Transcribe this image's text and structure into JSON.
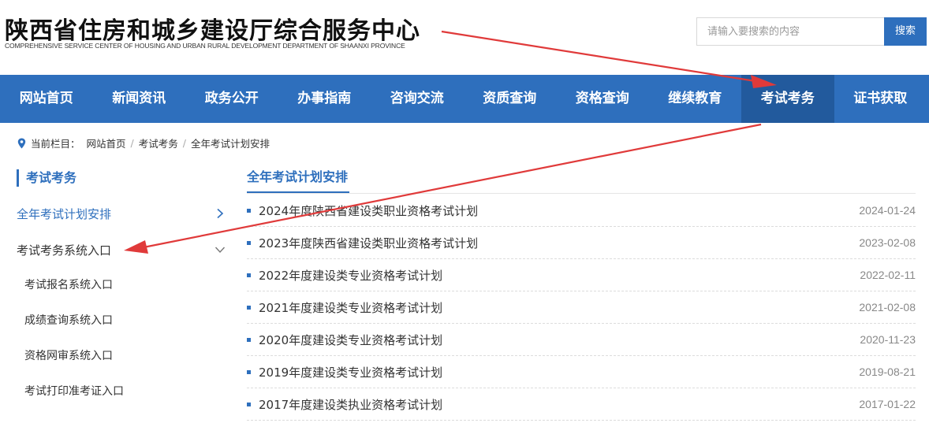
{
  "header": {
    "title": "陕西省住房和城乡建设厅综合服务中心",
    "subtitle": "COMPREHENSIVE SERVICE CENTER OF HOUSING AND URBAN RURAL DEVELOPMENT DEPARTMENT OF SHAANXI PROVINCE",
    "search_placeholder": "请输入要搜索的内容",
    "search_button": "搜索"
  },
  "nav": {
    "items": [
      {
        "label": "网站首页"
      },
      {
        "label": "新闻资讯"
      },
      {
        "label": "政务公开"
      },
      {
        "label": "办事指南"
      },
      {
        "label": "咨询交流"
      },
      {
        "label": "资质查询"
      },
      {
        "label": "资格查询"
      },
      {
        "label": "继续教育"
      },
      {
        "label": "考试考务",
        "active": true
      },
      {
        "label": "证书获取"
      }
    ]
  },
  "breadcrumb": {
    "prefix": "当前栏目：",
    "items": [
      "网站首页",
      "考试考务",
      "全年考试计划安排"
    ],
    "separator": "/"
  },
  "sidebar": {
    "heading": "考试考务",
    "items": [
      {
        "label": "全年考试计划安排",
        "current": true,
        "icon": "chevron-right-icon"
      },
      {
        "label": "考试考务系统入口",
        "icon": "chevron-down-icon"
      }
    ],
    "subitems": [
      {
        "label": "考试报名系统入口"
      },
      {
        "label": "成绩查询系统入口"
      },
      {
        "label": "资格网审系统入口"
      },
      {
        "label": "考试打印准考证入口"
      }
    ]
  },
  "content": {
    "tab": "全年考试计划安排",
    "list": [
      {
        "title": "2024年度陕西省建设类职业资格考试计划",
        "date": "2024-01-24"
      },
      {
        "title": "2023年度陕西省建设类职业资格考试计划",
        "date": "2023-02-08"
      },
      {
        "title": "2022年度建设类专业资格考试计划",
        "date": "2022-02-11"
      },
      {
        "title": "2021年度建设类专业资格考试计划",
        "date": "2021-02-08"
      },
      {
        "title": "2020年度建设类专业资格考试计划",
        "date": "2020-11-23"
      },
      {
        "title": "2019年度建设类专业资格考试计划",
        "date": "2019-08-21"
      },
      {
        "title": "2017年度建设类执业资格考试计划",
        "date": "2017-01-22"
      }
    ]
  },
  "colors": {
    "brand": "#2e6fbd",
    "nav_active": "#225a9d",
    "annotation_arrow": "#e03a3a"
  }
}
